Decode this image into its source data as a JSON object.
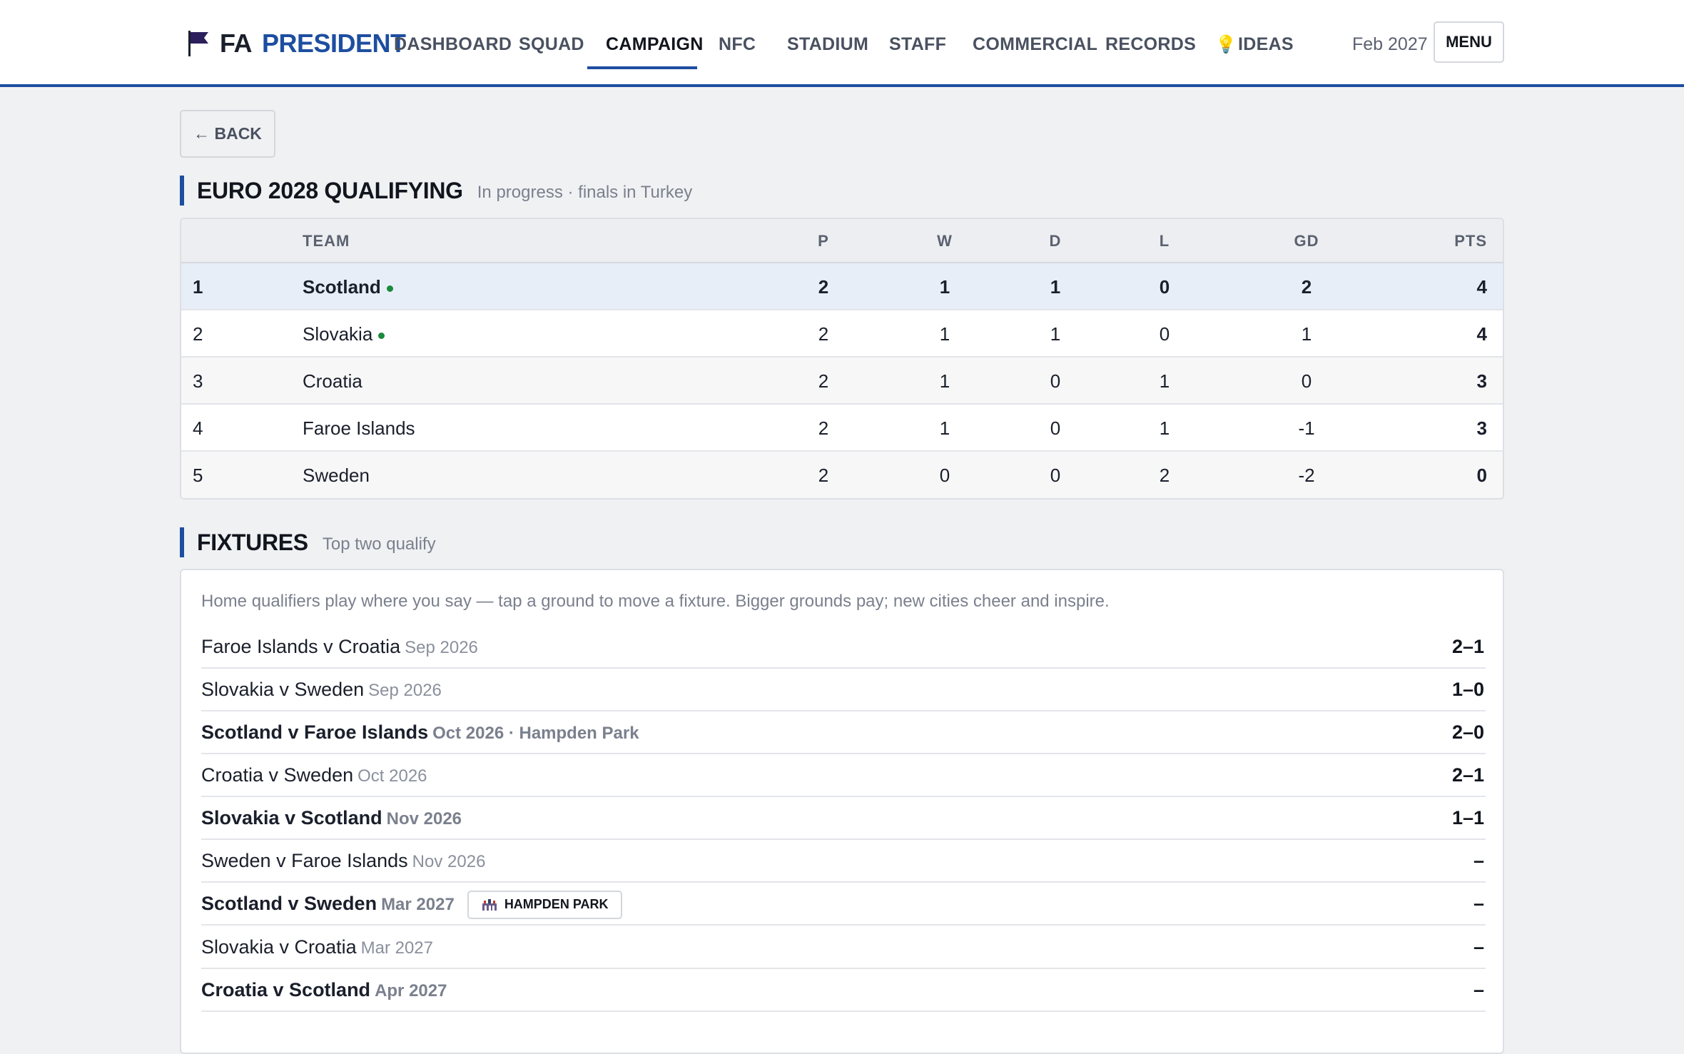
{
  "app": {
    "brand_prefix": "FA",
    "brand_name": "PRESIDENT",
    "date": "Feb 2027",
    "menu_label": "MENU"
  },
  "nav": [
    {
      "label": "DASHBOARD"
    },
    {
      "label": "SQUAD"
    },
    {
      "label": "CAMPAIGN"
    },
    {
      "label": "NFC"
    },
    {
      "label": "STADIUM"
    },
    {
      "label": "STAFF"
    },
    {
      "label": "COMMERCIAL"
    },
    {
      "label": "RECORDS"
    },
    {
      "label": "IDEAS",
      "icon": "lightbulb-icon"
    }
  ],
  "active_nav": "CAMPAIGN",
  "back_label": "← BACK",
  "qualifying": {
    "title": "EURO 2028 QUALIFYING",
    "subtitle": "In progress · finals in Turkey",
    "columns": [
      "",
      "TEAM",
      "P",
      "W",
      "D",
      "L",
      "GD",
      "PTS"
    ],
    "rows": [
      {
        "pos": "1",
        "team": "Scotland",
        "p": "2",
        "w": "1",
        "d": "1",
        "l": "0",
        "gd": "2",
        "pts": "4",
        "qualifying": true
      },
      {
        "pos": "2",
        "team": "Slovakia",
        "p": "2",
        "w": "1",
        "d": "1",
        "l": "0",
        "gd": "1",
        "pts": "4",
        "qualifying": true
      },
      {
        "pos": "3",
        "team": "Croatia",
        "p": "2",
        "w": "1",
        "d": "0",
        "l": "1",
        "gd": "0",
        "pts": "3",
        "qualifying": false
      },
      {
        "pos": "4",
        "team": "Faroe Islands",
        "p": "2",
        "w": "1",
        "d": "0",
        "l": "1",
        "gd": "-1",
        "pts": "3",
        "qualifying": false
      },
      {
        "pos": "5",
        "team": "Sweden",
        "p": "2",
        "w": "0",
        "d": "0",
        "l": "2",
        "gd": "-2",
        "pts": "0",
        "qualifying": false
      }
    ]
  },
  "fixtures": {
    "title": "FIXTURES",
    "subtitle": "Top two qualify",
    "note": "Home qualifiers play where you say — tap a ground to move a fixture. Bigger grounds pay; new cities cheer and inspire.",
    "items": [
      {
        "match": "Faroe Islands v Croatia",
        "date": "Sep 2026",
        "score": "2–1",
        "mine": false
      },
      {
        "match": "Slovakia v Sweden",
        "date": "Sep 2026",
        "score": "1–0",
        "mine": false
      },
      {
        "match": "Scotland v Faroe Islands",
        "date": "Oct 2026 · Hampden Park",
        "score": "2–0",
        "mine": true
      },
      {
        "match": "Croatia v Sweden",
        "date": "Oct 2026",
        "score": "2–1",
        "mine": false
      },
      {
        "match": "Slovakia v Scotland",
        "date": "Nov 2026",
        "score": "1–1",
        "mine": true
      },
      {
        "match": "Sweden v Faroe Islands",
        "date": "Nov 2026",
        "score": "–",
        "mine": false
      },
      {
        "match": "Scotland v Sweden",
        "date": "Mar 2027",
        "score": "–",
        "mine": true,
        "ground_button": "HAMPDEN PARK",
        "ground_icon": "stadium-icon"
      },
      {
        "match": "Slovakia v Croatia",
        "date": "Mar 2027",
        "score": "–",
        "mine": false
      },
      {
        "match": "Croatia v Scotland",
        "date": "Apr 2027",
        "score": "–",
        "mine": true
      }
    ]
  },
  "colors": {
    "accent": "#1d4ea0",
    "qualify_dot": "#1a8a3c",
    "page_bg": "#f0f1f3",
    "highlight_row": "#e8eef8"
  }
}
